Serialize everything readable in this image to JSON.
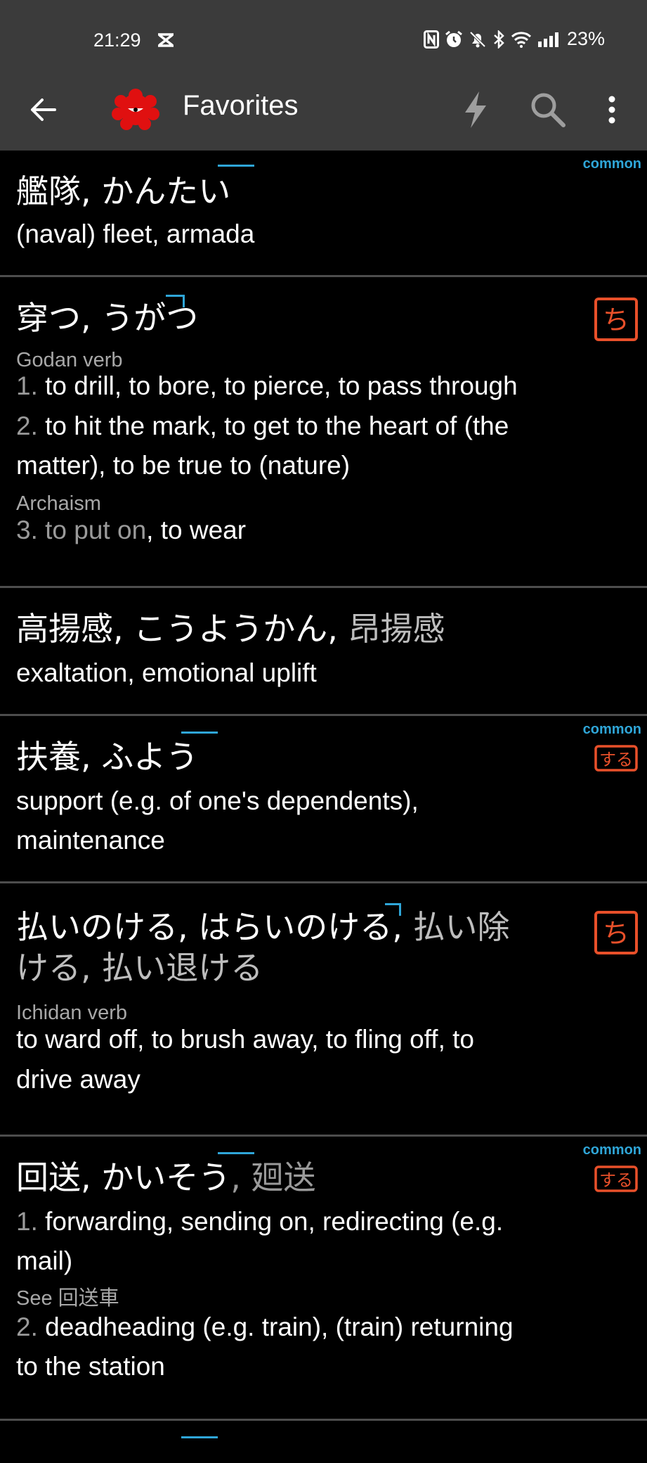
{
  "status": {
    "time": "21:29",
    "battery": "23%",
    "icons": [
      "nfc-icon",
      "alarm-icon",
      "mute-icon",
      "bluetooth-icon",
      "wifi-icon",
      "signal-icon"
    ]
  },
  "app_bar": {
    "title": "Favorites",
    "icons": [
      "back-arrow-icon",
      "app-logo-icon",
      "flash-icon",
      "search-icon",
      "more-vert-icon"
    ]
  },
  "colors": {
    "accent": "#2fa6d8",
    "badge": "#e8502a",
    "divider": "#4d4d4d",
    "bar": "#3b3b3b"
  },
  "entries": [
    {
      "kanji": "艦隊",
      "reading": "かんたい",
      "common": "common",
      "meaning": "(naval) fleet, armada"
    },
    {
      "kanji": "穿つ",
      "reading": "うがつ",
      "badge": "godan-verb-badge",
      "pos": "Godan verb",
      "senses": [
        {
          "num": "1.",
          "text": "to drill, to bore, to pierce, to pass through"
        },
        {
          "num": "2.",
          "text": "to hit the mark, to get to the heart of (the",
          "cont": "matter), to be true to (nature)"
        },
        {
          "note": "Archaism",
          "num": "3.",
          "text_dim": "to put on",
          "text": ", to wear"
        }
      ]
    },
    {
      "kanji": "高揚感",
      "reading": "こうようかん",
      "alt": "昂揚感",
      "meaning": "exaltation, emotional uplift"
    },
    {
      "kanji": "扶養",
      "reading": "ふよう",
      "common": "common",
      "badge": "suru-verb-badge",
      "meaning": "support (e.g. of one's dependents),",
      "meaning_cont": "maintenance"
    },
    {
      "kanji": "払いのける",
      "reading": "はらいのける",
      "alt": "払い除",
      "alt_cont": "ける, 払い退ける",
      "badge": "ichidan-verb-badge",
      "pos": "Ichidan verb",
      "meaning": "to ward off, to brush away, to fling off, to",
      "meaning_cont": "drive away"
    },
    {
      "kanji": "回送",
      "reading": "かいそう",
      "alt": "廻送",
      "common": "common",
      "badge": "suru-verb-badge",
      "senses": [
        {
          "num": "1.",
          "text": "forwarding, sending on, redirecting (e.g.",
          "cont": "mail)"
        },
        {
          "note": "See 回送車",
          "num": "2.",
          "text": "deadheading (e.g. train), (train) returning",
          "cont": "to the station"
        }
      ]
    }
  ],
  "badges": {
    "suru": "する",
    "verb": "ち"
  }
}
